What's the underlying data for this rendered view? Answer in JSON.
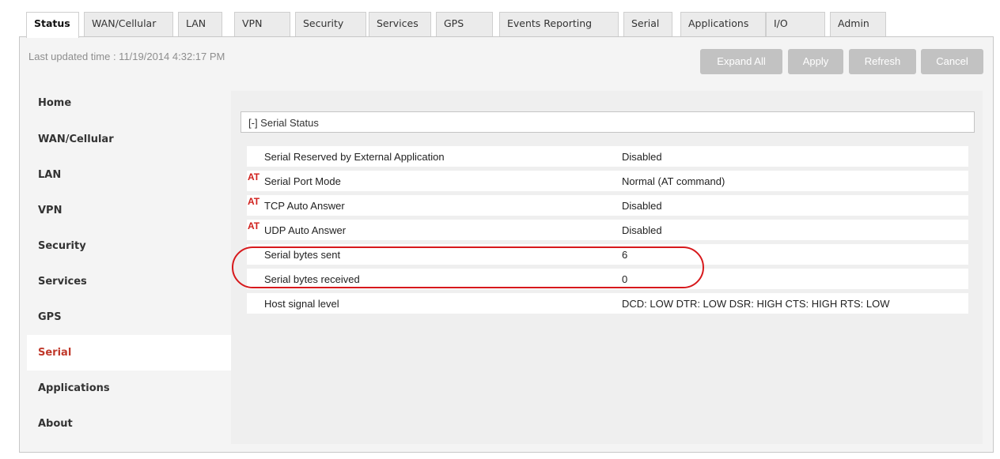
{
  "tabs": [
    {
      "label": "Status",
      "active": true
    },
    {
      "label": "WAN/Cellular"
    },
    {
      "label": "LAN"
    },
    {
      "label": "VPN"
    },
    {
      "label": "Security"
    },
    {
      "label": "Services"
    },
    {
      "label": "GPS"
    },
    {
      "label": "Events Reporting"
    },
    {
      "label": "Serial"
    },
    {
      "label": "Applications"
    },
    {
      "label": "I/O"
    },
    {
      "label": "Admin"
    }
  ],
  "header": {
    "last_updated": "Last updated time : 11/19/2014 4:32:17 PM"
  },
  "toolbar": {
    "expand_all_label": "Expand All",
    "apply_label": "Apply",
    "refresh_label": "Refresh",
    "cancel_label": "Cancel"
  },
  "sidebar": {
    "items": [
      {
        "label": "Home"
      },
      {
        "label": "WAN/Cellular"
      },
      {
        "label": "LAN"
      },
      {
        "label": "VPN"
      },
      {
        "label": "Security"
      },
      {
        "label": "Services"
      },
      {
        "label": "GPS"
      },
      {
        "label": "Serial",
        "active": true
      },
      {
        "label": "Applications"
      },
      {
        "label": "About"
      }
    ]
  },
  "section": {
    "title": "[-] Serial Status"
  },
  "rows": [
    {
      "label": "Serial Reserved by External Application",
      "value": "Disabled",
      "at": ""
    },
    {
      "label": "Serial Port Mode",
      "value": "Normal (AT command)",
      "at": "AT"
    },
    {
      "label": "TCP Auto Answer",
      "value": "Disabled",
      "at": "AT"
    },
    {
      "label": "UDP Auto Answer",
      "value": "Disabled",
      "at": "AT"
    },
    {
      "label": "Serial bytes sent",
      "value": "6",
      "at": ""
    },
    {
      "label": "Serial bytes received",
      "value": "0",
      "at": ""
    },
    {
      "label": "Host signal level",
      "value": "DCD: LOW DTR: LOW DSR: HIGH CTS: HIGH RTS: LOW",
      "at": ""
    }
  ],
  "colors": {
    "accent_red": "#c0392b",
    "annotation_red": "#d7191c",
    "button_gray": "#c2c2c2"
  }
}
